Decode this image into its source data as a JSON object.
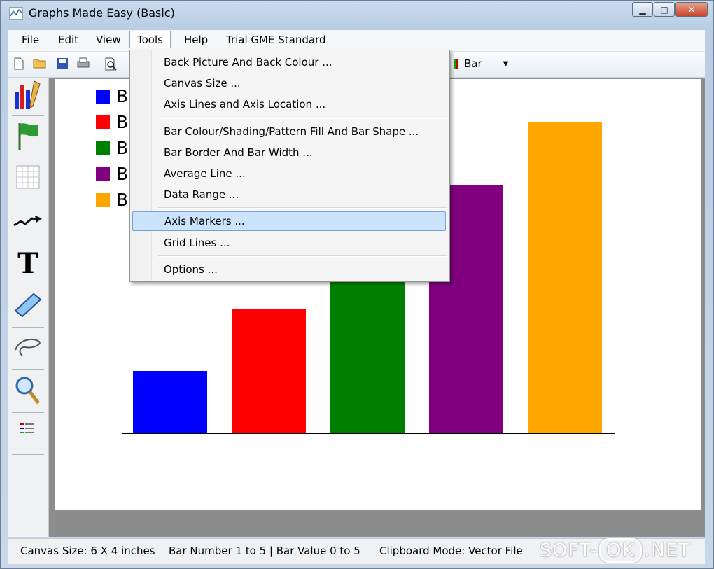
{
  "window": {
    "title": "Graphs Made Easy (Basic)"
  },
  "menubar": [
    {
      "label": "File"
    },
    {
      "label": "Edit"
    },
    {
      "label": "View"
    },
    {
      "label": "Tools",
      "active": true
    },
    {
      "label": "Help"
    },
    {
      "label": "Trial GME Standard"
    }
  ],
  "toolbar": {
    "chart_type": "Bar"
  },
  "tools_menu": {
    "items": [
      {
        "label": "Back Picture And Back Colour ..."
      },
      {
        "label": "Canvas Size ..."
      },
      {
        "label": "Axis Lines and Axis Location ..."
      },
      {
        "label": "Bar Colour/Shading/Pattern Fill And Bar Shape ..."
      },
      {
        "label": "Bar Border And Bar Width ..."
      },
      {
        "label": "Average Line ..."
      },
      {
        "label": "Data Range ..."
      },
      {
        "label": "Axis Markers ...",
        "highlighted": true
      },
      {
        "label": "Grid Lines ..."
      },
      {
        "label": "Options ..."
      }
    ]
  },
  "chart_data": {
    "type": "bar",
    "categories": [
      "B",
      "B",
      "B",
      "B",
      "B"
    ],
    "values": [
      1,
      2,
      3,
      4,
      5
    ],
    "colors": [
      "#0000ff",
      "#ff0000",
      "#008000",
      "#800080",
      "#ffa500"
    ],
    "ylim": [
      0,
      5
    ],
    "grid": false,
    "legend_position": "top-left",
    "legend": [
      "B",
      "B",
      "B",
      "B",
      "B"
    ]
  },
  "statusbar": {
    "canvas_size": "Canvas Size:  6 X 4  inches",
    "bar_info": "Bar Number 1 to 5  |  Bar Value 0 to 5",
    "clipboard": "Clipboard Mode: Vector File"
  },
  "watermark": {
    "left": "SOFT-",
    "box": "OK",
    "right": ".NET"
  }
}
